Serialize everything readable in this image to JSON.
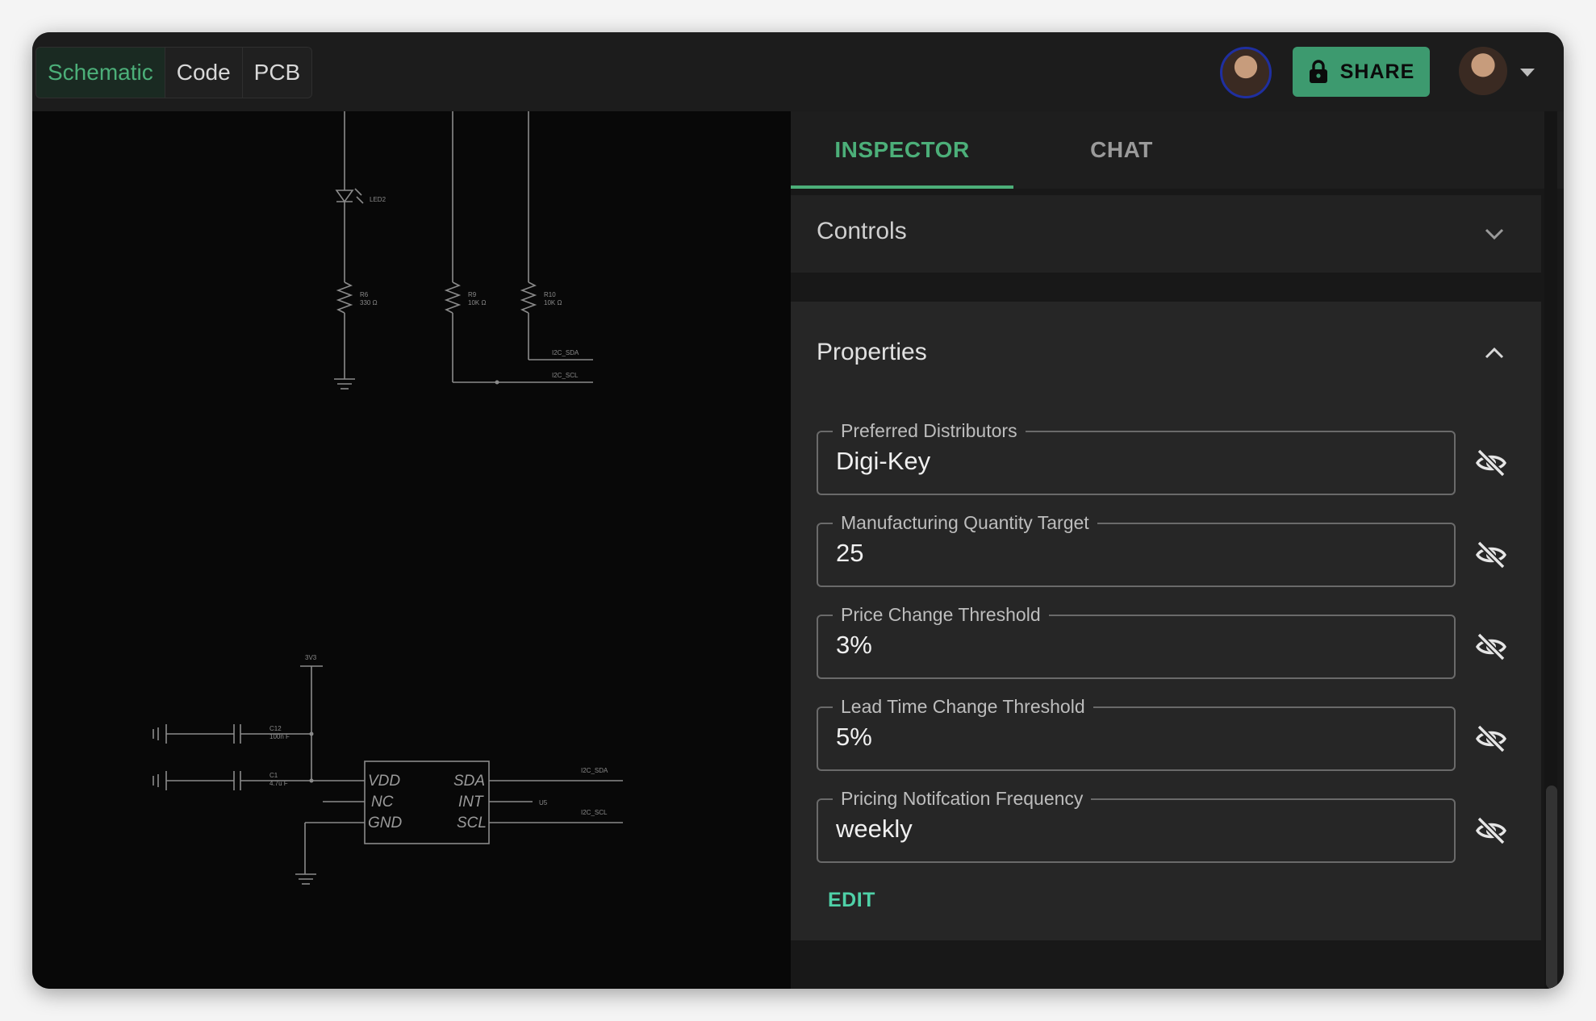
{
  "topbar": {
    "tabs": [
      {
        "label": "Schematic",
        "active": true
      },
      {
        "label": "Code",
        "active": false
      },
      {
        "label": "PCB",
        "active": false
      }
    ],
    "share_label": "SHARE",
    "share_icon": "lock-icon"
  },
  "colors": {
    "accent": "#4caf79",
    "share_bg": "#3d9a6f",
    "edit_link": "#4fd1a8"
  },
  "schematic": {
    "labels": {
      "led2": "LED2",
      "r6": "R6",
      "r6_val": "330 Ω",
      "r9": "R9",
      "r9_val": "10K Ω",
      "r10": "R10",
      "r10_val": "10K Ω",
      "i2c_sda_top": "I2C_SDA",
      "i2c_scl_top": "I2C_SCL",
      "rail_3v3": "3V3",
      "c12": "C12",
      "c12_val": "100n F",
      "c1": "C1",
      "c1_val": "4.7u F",
      "pin_vdd": "VDD",
      "pin_nc": "NC",
      "pin_gnd": "GND",
      "pin_sda": "SDA",
      "pin_int": "INT",
      "pin_scl": "SCL",
      "u5": "U5",
      "i2c_sda_bot": "I2C_SDA",
      "i2c_scl_bot": "I2C_SCL"
    }
  },
  "panel": {
    "tabs": [
      {
        "label": "INSPECTOR",
        "active": true
      },
      {
        "label": "CHAT",
        "active": false
      }
    ],
    "controls": {
      "title": "Controls",
      "expanded": false
    },
    "properties": {
      "title": "Properties",
      "expanded": true,
      "fields": [
        {
          "label": "Preferred Distributors",
          "value": "Digi-Key"
        },
        {
          "label": "Manufacturing Quantity Target",
          "value": "25"
        },
        {
          "label": "Price Change Threshold",
          "value": "3%"
        },
        {
          "label": "Lead Time Change Threshold",
          "value": "5%"
        },
        {
          "label": "Pricing Notifcation Frequency",
          "value": "weekly"
        }
      ],
      "edit_label": "EDIT"
    }
  }
}
